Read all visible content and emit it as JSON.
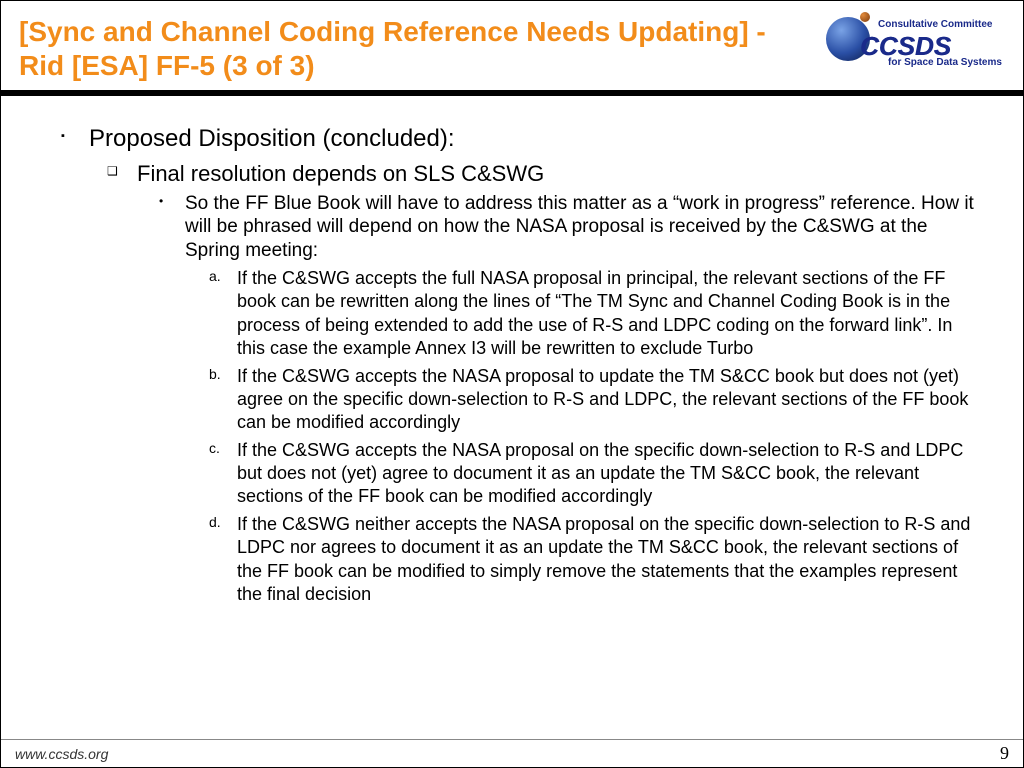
{
  "header": {
    "title": "[Sync and Channel Coding Reference Needs Updating] - Rid [ESA] FF-5 (3 of 3)",
    "logo": {
      "top_text": "Consultative Committee",
      "word": "CCSDS",
      "bottom_text": "for Space Data Systems"
    }
  },
  "body": {
    "l1": "Proposed Disposition (concluded):",
    "l2": "Final resolution depends on SLS C&SWG",
    "l3": "So the FF Blue Book will have to address this matter as a “work in progress” reference. How it will be phrased will depend on how the NASA proposal is received by the C&SWG at the Spring meeting:",
    "l4": [
      {
        "marker": "a.",
        "text": "If the C&SWG accepts the full NASA proposal in principal, the relevant sections of the FF book can be rewritten along the lines of “The TM Sync and Channel Coding Book is in the process of being extended to add the use of R-S and LDPC coding on the forward link”. In this case the example Annex I3 will be rewritten to exclude Turbo"
      },
      {
        "marker": "b.",
        "text": "If the C&SWG accepts the NASA proposal to update the TM S&CC book but does not (yet) agree on the specific down-selection to R-S and LDPC, the relevant sections of the FF book can be modified accordingly"
      },
      {
        "marker": "c.",
        "text": "If the C&SWG accepts the NASA proposal on the specific down-selection to R-S and LDPC but does not (yet) agree to document it as an update the TM S&CC book, the relevant sections of the FF book can be modified accordingly"
      },
      {
        "marker": "d.",
        "text": "If the C&SWG neither accepts the NASA proposal on the specific down-selection to R-S and LDPC nor agrees to document it as an update the TM S&CC book, the relevant sections of the FF book can be modified to simply remove the statements that the examples represent the final decision"
      }
    ]
  },
  "footer": {
    "url": "www.ccsds.org",
    "page": "9"
  }
}
